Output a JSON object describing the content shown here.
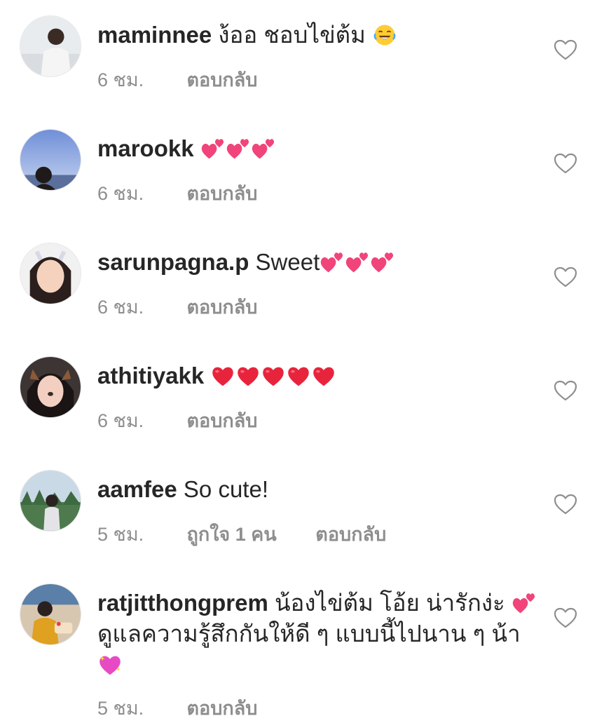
{
  "comments": [
    {
      "username": "maminnee",
      "text": "ง้ออ ชอบไข่ต้ม",
      "emoji": "laughing-tears",
      "time": "6 ชม.",
      "reply": "ตอบกลับ"
    },
    {
      "username": "marookk",
      "text": "",
      "emoji": "two-hearts x3",
      "time": "6 ชม.",
      "reply": "ตอบกลับ"
    },
    {
      "username": "sarunpagna.p",
      "text": "Sweet",
      "emoji": "two-hearts x3",
      "time": "6 ชม.",
      "reply": "ตอบกลับ"
    },
    {
      "username": "athitiyakk",
      "text": "",
      "emoji": "red-heart x5",
      "time": "6 ชม.",
      "reply": "ตอบกลับ"
    },
    {
      "username": "aamfee",
      "text": "So cute!",
      "time": "5 ชม.",
      "likes": "ถูกใจ 1 คน",
      "reply": "ตอบกลับ"
    },
    {
      "username": "ratjitthongprem",
      "text_part1": "น้องไข่ต้ม โอ้ย น่ารักง่ะ",
      "text_part2": "ดูแลความรู้สึกกันให้ดี ๆ แบบนี้ไปนาน ๆ",
      "text_part3": "น้า",
      "emoji": "two-hearts, sparkling-heart",
      "time": "5 ชม.",
      "reply": "ตอบกลับ"
    }
  ],
  "colors": {
    "primary_text": "#262626",
    "secondary_text": "#8e8e8e",
    "heart_pink": "#f0447a",
    "heart_red": "#e8243c"
  }
}
